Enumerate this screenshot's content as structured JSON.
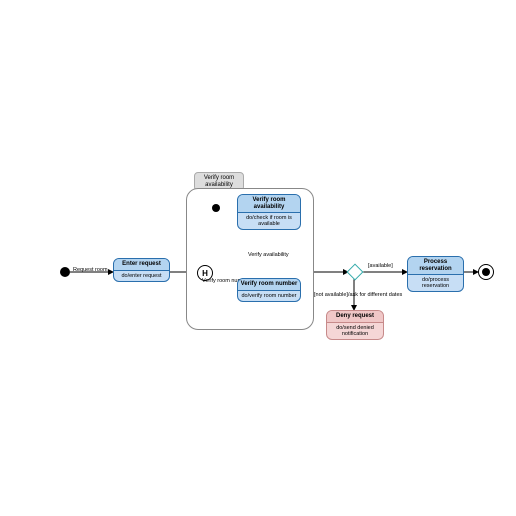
{
  "diagram": {
    "title": "Verify room availability",
    "initial_label": "Request room",
    "enter": {
      "title": "Enter request",
      "body": "do/enter request"
    },
    "verify_avail": {
      "title": "Verify room availability",
      "body": "do/check if room is available"
    },
    "verify_num": {
      "title": "Verify room number",
      "body": "do/verify room number"
    },
    "process": {
      "title": "Process reservation",
      "body": "do/process reservation"
    },
    "deny": {
      "title": "Deny request",
      "body": "do/send denied notification"
    },
    "history": "H",
    "edges": {
      "e1": "Verify availability",
      "e2": "Verify room number",
      "e3": "[available]",
      "e4": "[not available]/ask for different dates"
    }
  }
}
